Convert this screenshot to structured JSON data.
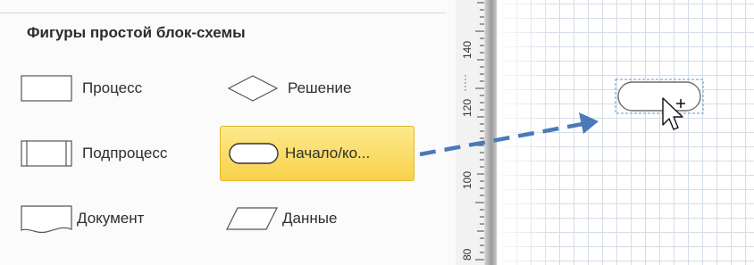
{
  "stencil": {
    "title": "Фигуры простой блок-схемы",
    "items": [
      {
        "label": "Процесс",
        "shape": "process-shape"
      },
      {
        "label": "Решение",
        "shape": "decision-shape"
      },
      {
        "label": "Подпроцесс",
        "shape": "subprocess-shape"
      },
      {
        "label": "Начало/ко...",
        "shape": "start-end-shape",
        "selected": true
      },
      {
        "label": "Документ",
        "shape": "document-shape"
      },
      {
        "label": "Данные",
        "shape": "data-shape"
      }
    ]
  },
  "ruler": {
    "labels": [
      "140",
      "120",
      "100",
      "80"
    ]
  },
  "colors": {
    "selection_fill": "#f8d14a",
    "arrow": "#4a7ab8",
    "grid": "#d6dde6",
    "dropped_outline": "#5b9bd5"
  }
}
